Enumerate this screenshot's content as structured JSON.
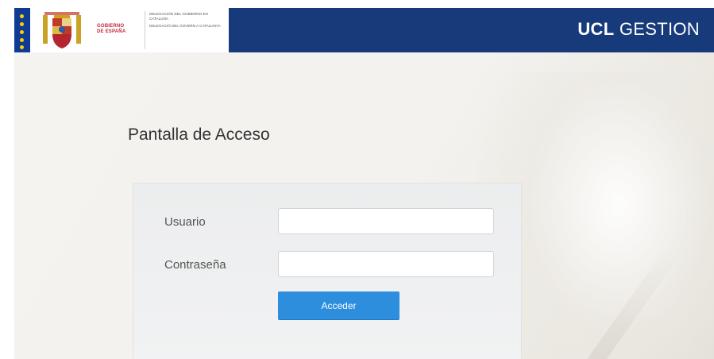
{
  "header": {
    "brand_bold": "UCL",
    "brand_rest": " GESTION",
    "gov_line1": "GOBIERNO",
    "gov_line2": "DE ESPAÑA",
    "deleg_line1": "DELEGACIÓN DEL GOBIERNO EN CATALUÑA",
    "deleg_line2": "DELEGACIÓ DEL GOVERN A CATALUNYA",
    "bar_color": "#173a7a"
  },
  "login": {
    "title": "Pantalla de Acceso",
    "user_label": "Usuario",
    "user_value": "",
    "password_label": "Contraseña",
    "password_value": "",
    "submit_label": "Acceder",
    "button_color": "#2e8ede"
  },
  "icons": {
    "eu_flag": "eu-flag-icon",
    "coat_of_arms": "spain-coat-of-arms-icon"
  }
}
